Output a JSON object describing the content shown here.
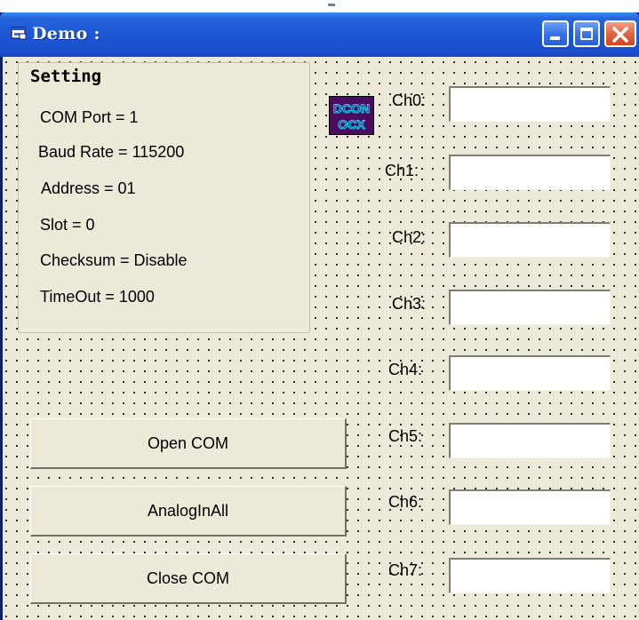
{
  "window": {
    "title": "Demo :",
    "title_color": "#ffffff",
    "titlebar_color": "#2766dd"
  },
  "setting": {
    "caption": "Setting",
    "lines": [
      "COM Port = 1",
      "Baud Rate = 115200",
      "Address = 01",
      "Slot = 0",
      "Checksum = Disable",
      "TimeOut = 1000"
    ]
  },
  "ocx": {
    "line1": "DCON",
    "line2": "OCX",
    "text_color": "#00e5ff",
    "bg_color": "#4b0b5f"
  },
  "channels": [
    {
      "label": "Ch0:",
      "value": ""
    },
    {
      "label": "Ch1:",
      "value": ""
    },
    {
      "label": "Ch2:",
      "value": ""
    },
    {
      "label": "Ch3:",
      "value": ""
    },
    {
      "label": "Ch4:",
      "value": ""
    },
    {
      "label": "Ch5:",
      "value": ""
    },
    {
      "label": "Ch6:",
      "value": ""
    },
    {
      "label": "Ch7:",
      "value": ""
    }
  ],
  "buttons": {
    "open": "Open COM",
    "analog": "AnalogInAll",
    "close": "Close COM"
  },
  "icons": {
    "app": "form-window-icon",
    "minimize": "minimize-icon",
    "maximize": "maximize-icon",
    "close": "close-icon"
  }
}
